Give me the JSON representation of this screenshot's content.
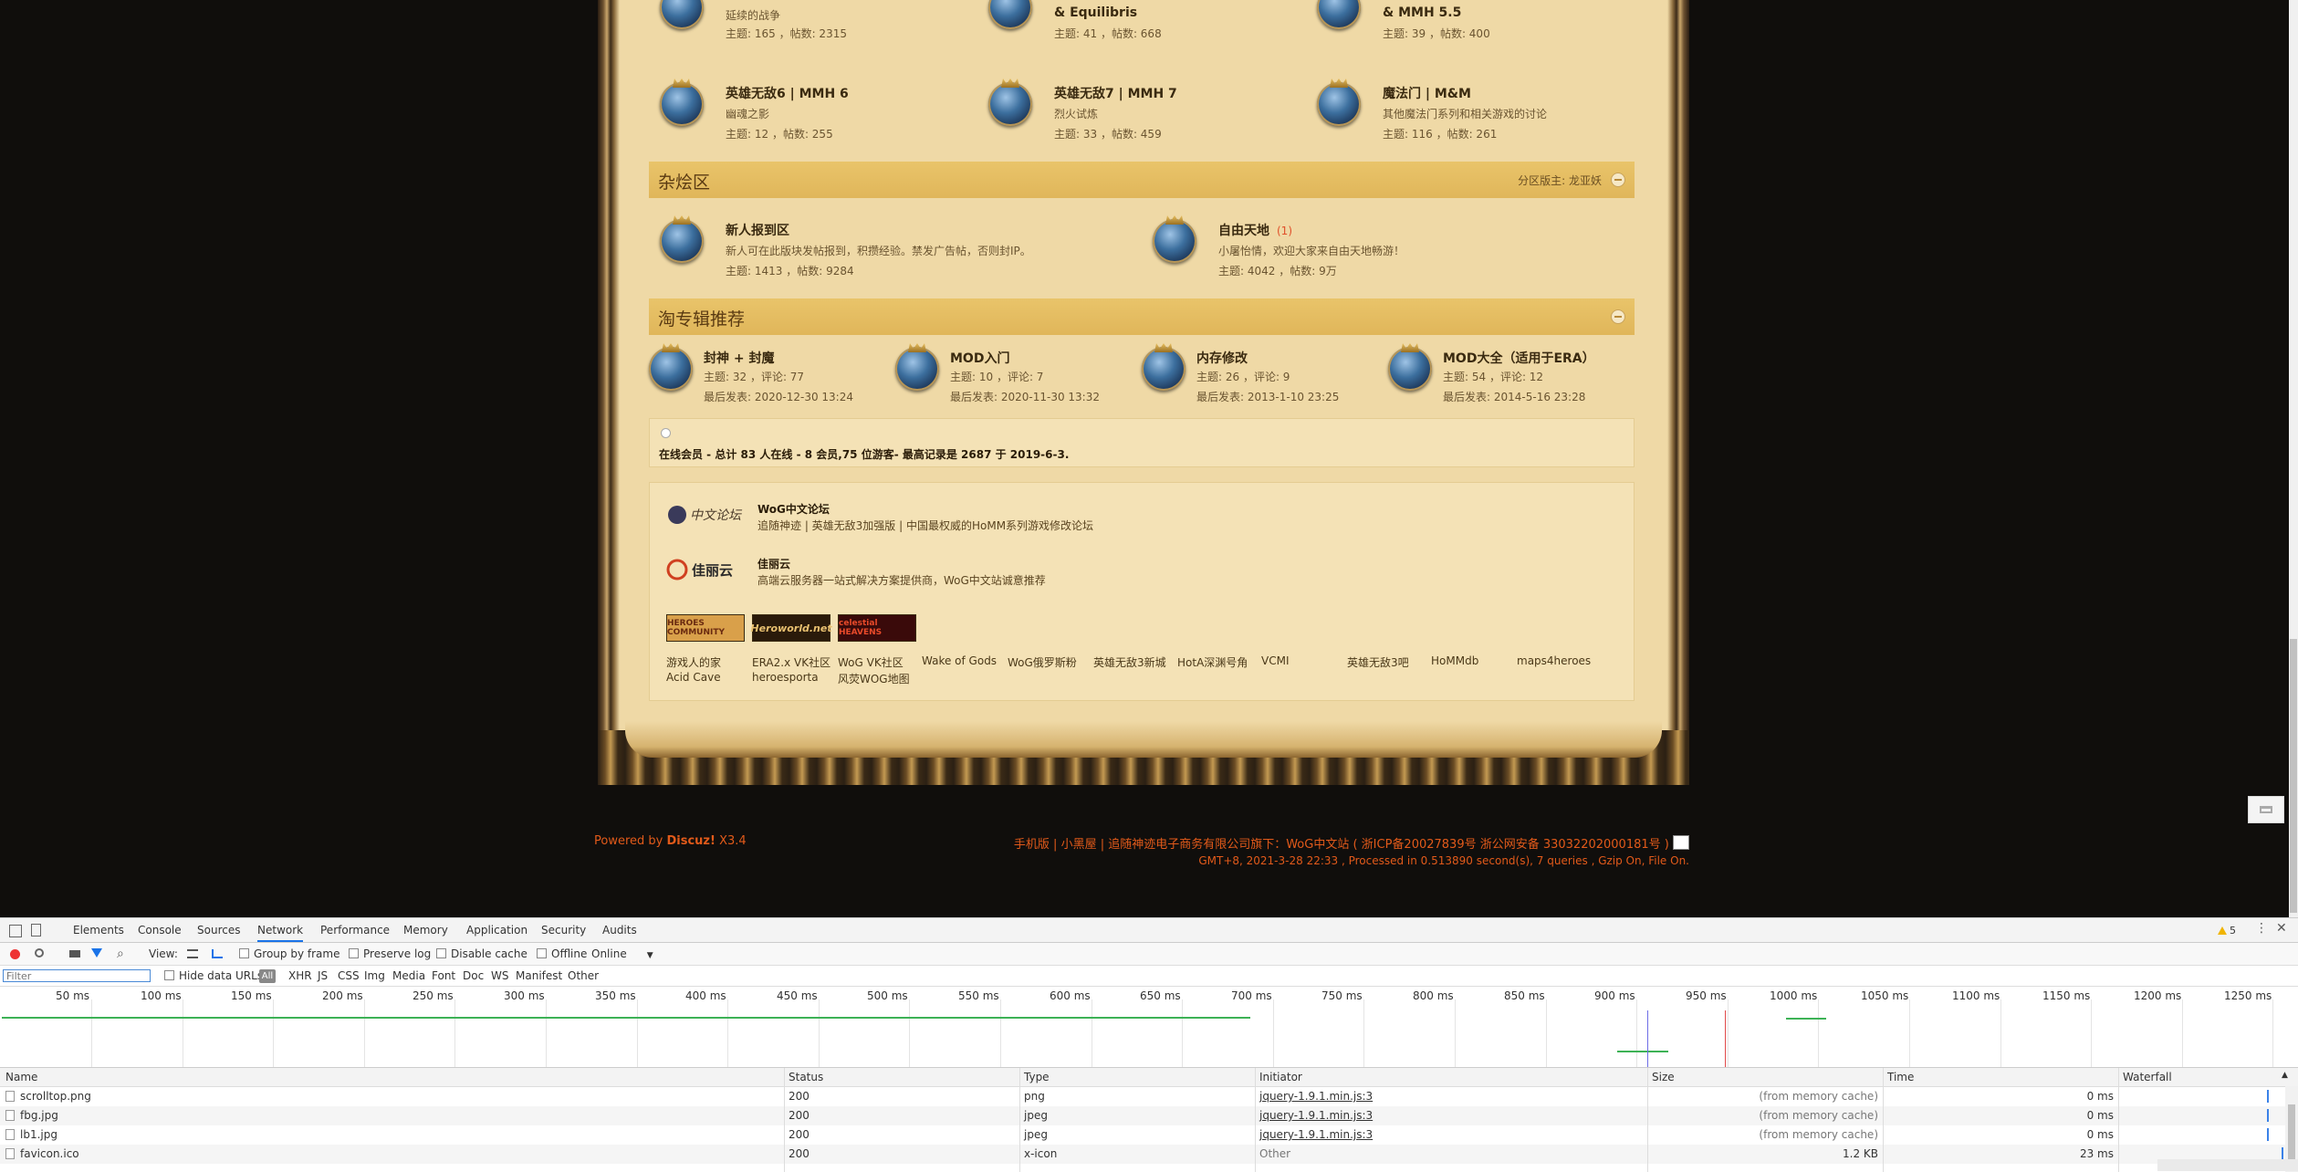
{
  "forums_top": [
    {
      "name": "",
      "desc": "延续的战争",
      "stats": "主题: 165 ，帖数: 2315"
    },
    {
      "name": "& Equilibris",
      "desc": "",
      "stats": "主题: 41 ，帖数: 668"
    },
    {
      "name": "& MMH 5.5",
      "desc": "",
      "stats": "主题: 39 ，帖数: 400"
    }
  ],
  "forums_row2": [
    {
      "name": "英雄无敌6 | MMH 6",
      "desc": "幽魂之影",
      "stats": "主题: 12 ，帖数: 255"
    },
    {
      "name": "英雄无敌7 | MMH 7",
      "desc": "烈火试炼",
      "stats": "主题: 33 ，帖数: 459"
    },
    {
      "name": "魔法门 | M&M",
      "desc": "其他魔法门系列和相关游戏的讨论",
      "stats": "主题: 116 ，帖数: 261"
    }
  ],
  "section_misc": {
    "title": "杂烩区",
    "moderator": "分区版主: 龙亚妖"
  },
  "forums_misc": [
    {
      "name": "新人报到区",
      "badge": "",
      "desc": "新人可在此版块发帖报到，积攒经验。禁发广告帖，否则封IP。",
      "stats": "主题: 1413 ，帖数: 9284"
    },
    {
      "name": "自由天地",
      "badge": "(1)",
      "desc": "小屠怡情，欢迎大家来自由天地畅游！",
      "stats": "主题: 4042 ，帖数: 9万"
    }
  ],
  "section_topics": {
    "title": "淘专辑推荐"
  },
  "topics": [
    {
      "name": "封神 + 封魔",
      "stats": "主题: 32 ，评论: 77",
      "last": "最后发表: 2020-12-30 13:24"
    },
    {
      "name": "MOD入门",
      "stats": "主题: 10 ，评论: 7",
      "last": "最后发表: 2020-11-30 13:32"
    },
    {
      "name": "内存修改",
      "stats": "主题: 26 ，评论: 9",
      "last": "最后发表: 2013-1-10 23:25"
    },
    {
      "name": "MOD大全（适用于ERA）",
      "stats": "主题: 54 ，评论: 12",
      "last": "最后发表: 2014-5-16 23:28"
    }
  ],
  "online": {
    "text": "在线会员 - 总计 83 人在线 - 8 会员,75 位游客- 最高记录是 2687 于 2019-6-3."
  },
  "partners": [
    {
      "logo": "中文论坛",
      "name": "WoG中文论坛",
      "desc": "追随神迹 | 英雄无敌3加强版 | 中国最权威的HoMM系列游戏修改论坛"
    },
    {
      "logo": "佳丽云",
      "name": "佳丽云",
      "desc": "高端云服务器一站式解决方案提供商，WoG中文站诚意推荐"
    }
  ],
  "banners": [
    {
      "label": "HEROES COMMUNITY",
      "bg": "#d9a04a",
      "fg": "#6a2a10"
    },
    {
      "label": "Heroworld.net",
      "bg": "#2a1a0a",
      "fg": "#e8c070"
    },
    {
      "label": "celestial HEAVENS",
      "bg": "#3a0a0a",
      "fg": "#e84a2a"
    }
  ],
  "links_row1": [
    "游戏人的家",
    "ERA2.x VK社区",
    "WoG VK社区",
    "Wake of Gods",
    "WoG俄罗斯粉",
    "英雄无敌3新城",
    "HotA深渊号角",
    "VCMI",
    "英雄无敌3吧",
    "HoMMdb",
    "maps4heroes"
  ],
  "links_row2": [
    "Acid Cave",
    "heroesporta",
    "风荧WOG地图"
  ],
  "footer": {
    "powered": "Powered by ",
    "discuz": "Discuz!",
    "version": " X3.4",
    "right_line1": "手机版 | 小黑屋 | 追随神迹电子商务有限公司旗下：WoG中文站 ( 浙ICP备20027839号 浙公网安备 33032202000181号 )",
    "right_line2": "GMT+8, 2021-3-28 22:33 , Processed in 0.513890 second(s), 7 queries , Gzip On, File On."
  },
  "devtools": {
    "tabs": [
      "Elements",
      "Console",
      "Sources",
      "Network",
      "Performance",
      "Memory",
      "Application",
      "Security",
      "Audits"
    ],
    "active_tab": "Network",
    "warnings": "5",
    "toolbar": {
      "view": "View:",
      "group": "Group by frame",
      "preserve": "Preserve log",
      "disable": "Disable cache",
      "offline": "Offline",
      "throttle": "Online"
    },
    "filter_placeholder": "Filter",
    "filter_types": [
      "Hide data URLs",
      "All",
      "XHR",
      "JS",
      "CSS",
      "Img",
      "Media",
      "Font",
      "Doc",
      "WS",
      "Manifest",
      "Other"
    ],
    "ticks": [
      "50 ms",
      "100 ms",
      "150 ms",
      "200 ms",
      "250 ms",
      "300 ms",
      "350 ms",
      "400 ms",
      "450 ms",
      "500 ms",
      "550 ms",
      "600 ms",
      "650 ms",
      "700 ms",
      "750 ms",
      "800 ms",
      "850 ms",
      "900 ms",
      "950 ms",
      "1000 ms",
      "1050 ms",
      "1100 ms",
      "1150 ms",
      "1200 ms",
      "1250 ms"
    ],
    "columns": [
      "Name",
      "Status",
      "Type",
      "Initiator",
      "Size",
      "Time",
      "Waterfall"
    ],
    "rows": [
      {
        "name": "scrolltop.png",
        "status": "200",
        "type": "png",
        "initiator": "jquery-1.9.1.min.js:3",
        "size": "(from memory cache)",
        "time": "0 ms"
      },
      {
        "name": "fbg.jpg",
        "status": "200",
        "type": "jpeg",
        "initiator": "jquery-1.9.1.min.js:3",
        "size": "(from memory cache)",
        "time": "0 ms"
      },
      {
        "name": "lb1.jpg",
        "status": "200",
        "type": "jpeg",
        "initiator": "jquery-1.9.1.min.js:3",
        "size": "(from memory cache)",
        "time": "0 ms"
      },
      {
        "name": "favicon.ico",
        "status": "200",
        "type": "x-icon",
        "initiator": "Other",
        "size": "1.2 KB",
        "time": "23 ms"
      }
    ]
  }
}
